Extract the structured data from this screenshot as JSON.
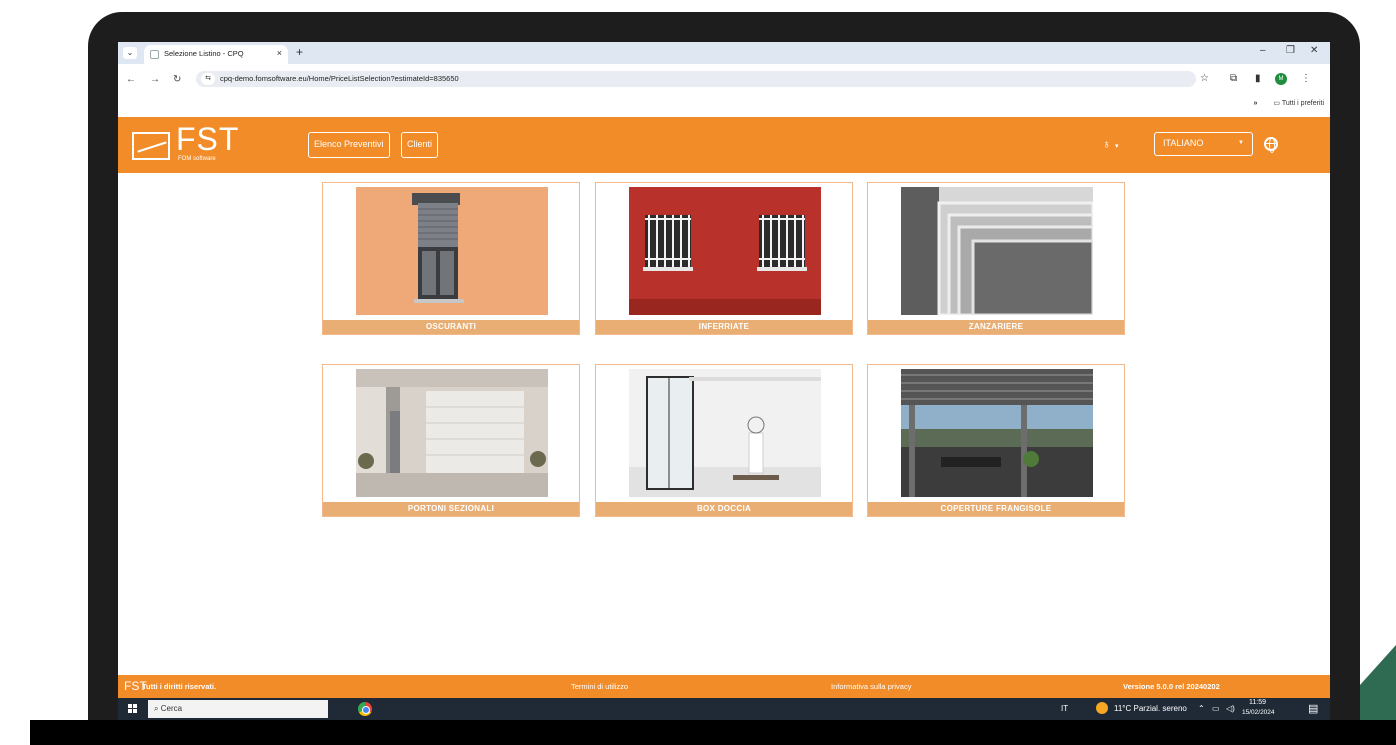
{
  "browser": {
    "tab_title": "Selezione Listino - CPQ",
    "tab_close": "×",
    "new_tab": "+",
    "url": "cpq-demo.fomsoftware.eu/Home/PriceListSelection?estimateId=835650",
    "bookmarks_overflow": "»",
    "bookmarks_folder": "Tutti i preferiti",
    "profile_initial": "M",
    "window_controls": [
      "–",
      "❐",
      "✕"
    ]
  },
  "header": {
    "logo_text": "FST",
    "logo_sub": "FOM software",
    "nav": [
      {
        "label": "Elenco Preventivi"
      },
      {
        "label": "Clienti"
      }
    ],
    "user_caret": "▾",
    "language": "ITALIANO",
    "language_caret": "▼"
  },
  "products": [
    {
      "label": "OSCURANTI"
    },
    {
      "label": "INFERRIATE"
    },
    {
      "label": "ZANZARIERE"
    },
    {
      "label": "PORTONI SEZIONALI"
    },
    {
      "label": "BOX DOCCIA"
    },
    {
      "label": "COPERTURE FRANGISOLE"
    }
  ],
  "footer": {
    "logo": "FST",
    "rights": "Tutti i diritti riservati.",
    "terms": "Termini di utilizzo",
    "privacy": "Informativa sulla privacy",
    "version": "Versione 5.0.0 rel 20240202"
  },
  "taskbar": {
    "search_placeholder": "Cerca",
    "lang": "IT",
    "weather": "11°C  Parzial. sereno",
    "time": "11:59",
    "date": "15/02/2024"
  },
  "colors": {
    "accent": "#f28c28",
    "card_label": "#e8ae74",
    "card_border": "#f4b98a",
    "taskbar": "#1f2a36"
  }
}
